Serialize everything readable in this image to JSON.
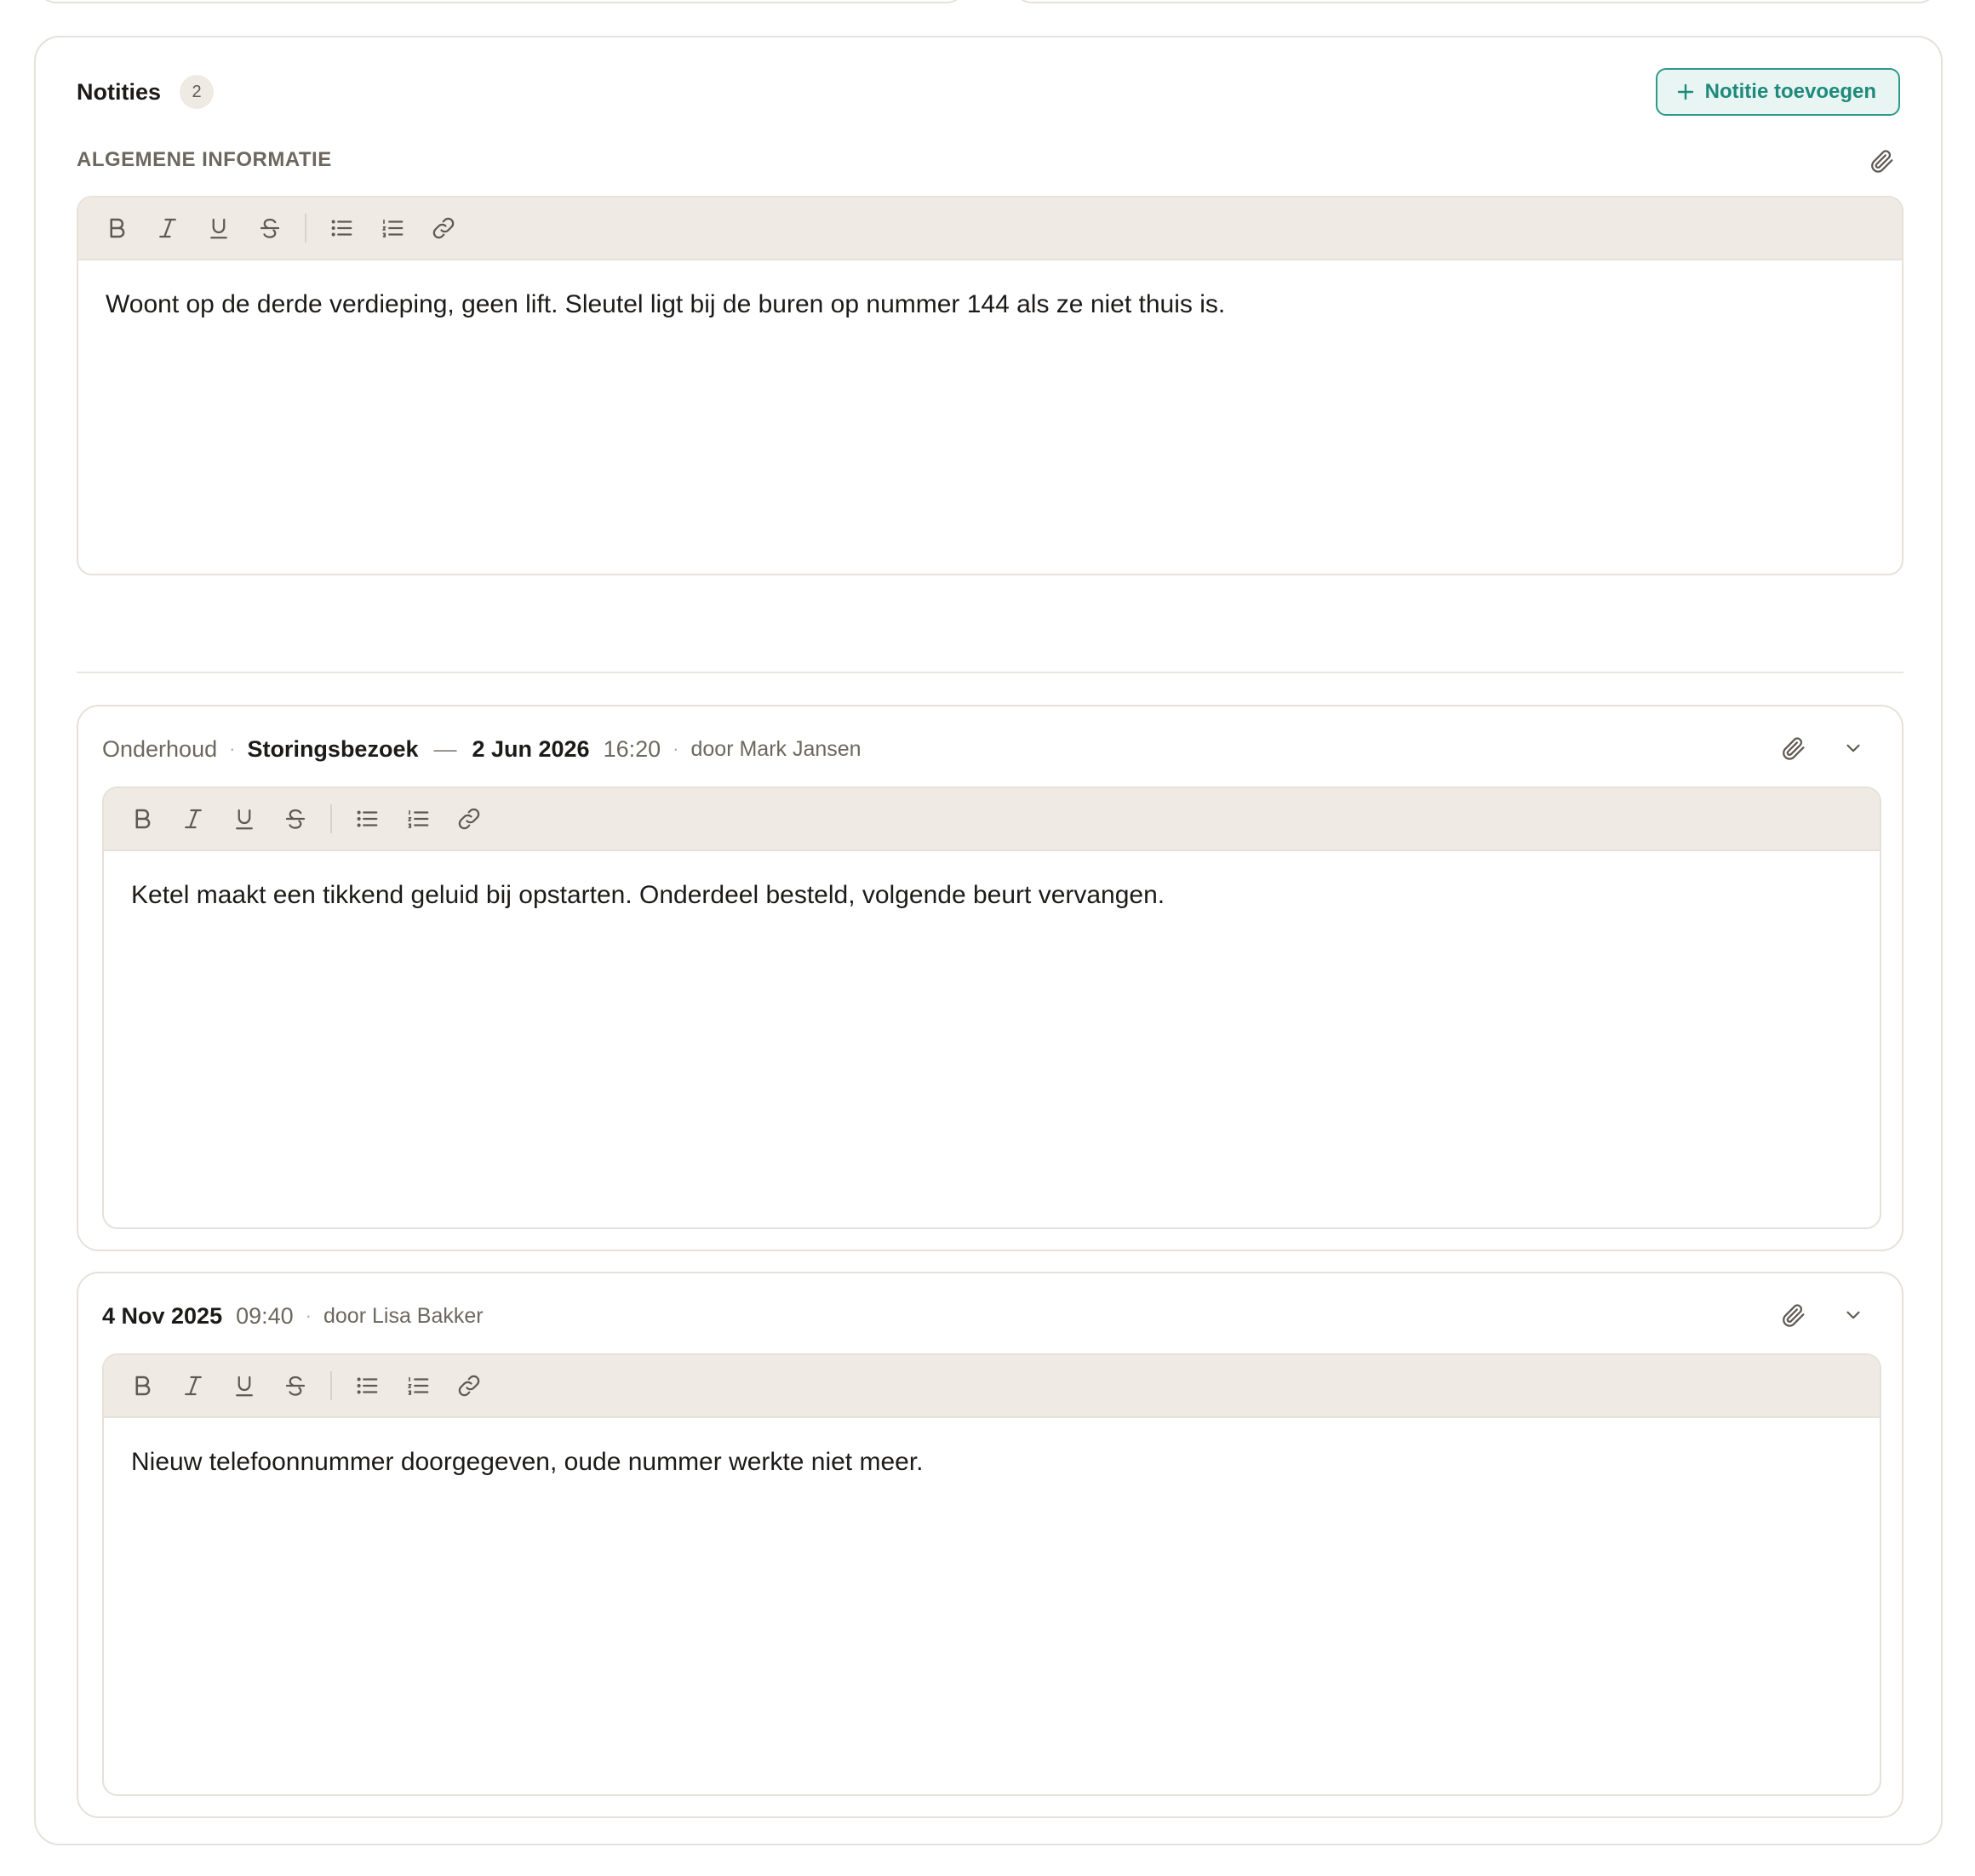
{
  "header": {
    "title": "Notities",
    "count": "2",
    "add_label": "Notitie toevoegen"
  },
  "general": {
    "label": "ALGEMENE INFORMATIE",
    "text": "Woont op de derde verdieping, geen lift. Sleutel ligt bij de buren op nummer 144 als ze niet thuis is."
  },
  "toolbar": {
    "buttons": [
      "bold-icon",
      "italic-icon",
      "underline-icon",
      "strikethrough-icon",
      "bullet-list-icon",
      "numbered-list-icon",
      "link-icon"
    ]
  },
  "notes": [
    {
      "category": "Onderhoud",
      "type": "Storingsbezoek",
      "date": "2 Jun 2026",
      "time": "16:20",
      "author": "door Mark Jansen",
      "text": "Ketel maakt een tikkend geluid bij opstarten. Onderdeel besteld, volgende beurt vervangen."
    },
    {
      "date": "4 Nov 2025",
      "time": "09:40",
      "author": "door Lisa Bakker",
      "text": "Nieuw telefoonnummer doorgegeven, oude nummer werkte niet meer."
    }
  ],
  "colors": {
    "accent": "#2e9a8c",
    "toolbar_bg": "#efeae4",
    "border": "#e6e1d9"
  }
}
